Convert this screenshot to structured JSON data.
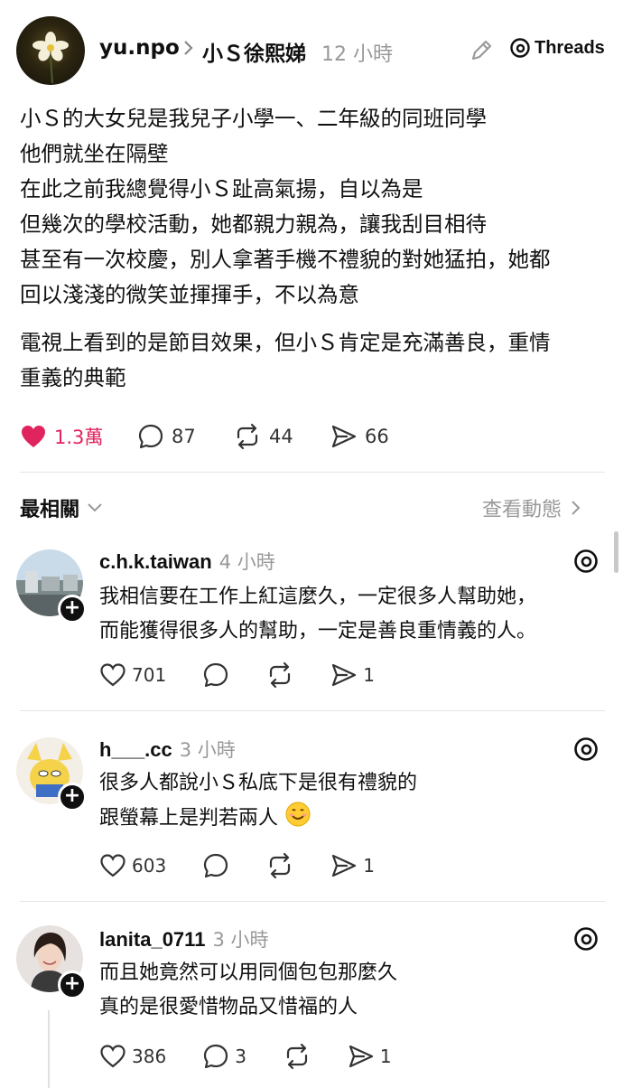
{
  "post": {
    "author": "yu.npo",
    "thread_title": "小Ｓ徐熙娣",
    "time": "12 小時",
    "brand": "Threads",
    "body_para1": [
      "小Ｓ的大女兒是我兒子小學一、二年級的同班同學",
      "他們就坐在隔壁",
      "在此之前我總覺得小Ｓ趾高氣揚，自以為是",
      "但幾次的學校活動，她都親力親為，讓我刮目相待",
      "甚至有一次校慶，別人拿著手機不禮貌的對她猛拍，她都",
      "回以淺淺的微笑並揮揮手，不以為意"
    ],
    "body_para2": [
      "電視上看到的是節目效果，但小Ｓ肯定是充滿善良，重情",
      "重義的典範"
    ],
    "likes": "1.3萬",
    "comments": "87",
    "reposts": "44",
    "shares": "66",
    "like_color": "#e0245e"
  },
  "replies_header": {
    "sort_label": "最相關",
    "view_activity": "查看動態"
  },
  "replies": [
    {
      "user": "c.h.k.taiwan",
      "time": "4 小時",
      "lines": [
        "我相信要在工作上紅這麼久，一定很多人幫助她，",
        "而能獲得很多人的幫助，一定是善良重情義的人。"
      ],
      "likes": "701",
      "comments": "",
      "shares": "1"
    },
    {
      "user": "h___.cc",
      "time": "3 小時",
      "lines": [
        "很多人都說小Ｓ私底下是很有禮貌的",
        "跟螢幕上是判若兩人"
      ],
      "emoji": "smiling-face",
      "likes": "603",
      "comments": "",
      "shares": "1"
    },
    {
      "user": "lanita_0711",
      "time": "3 小時",
      "lines": [
        "而且她竟然可以用同個包包那麼久",
        "真的是很愛惜物品又惜福的人"
      ],
      "likes": "386",
      "comments": "3",
      "shares": "1"
    }
  ]
}
